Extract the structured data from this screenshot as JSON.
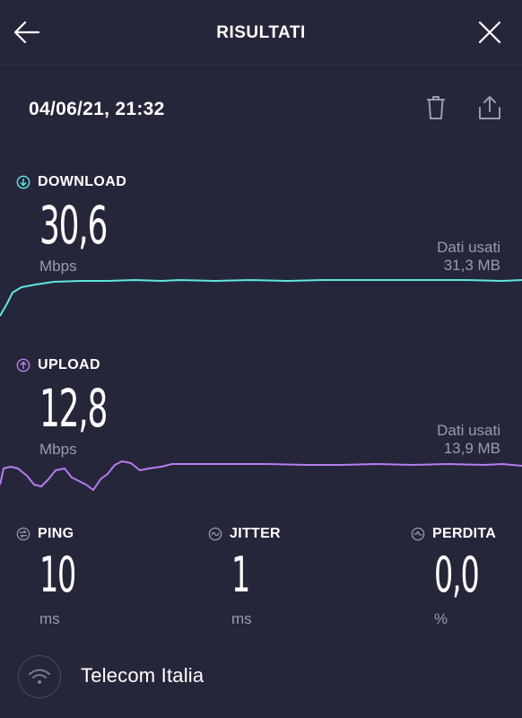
{
  "header": {
    "title": "RISULTATI"
  },
  "result": {
    "datetime": "04/06/21, 21:32"
  },
  "download": {
    "label": "DOWNLOAD",
    "value": "30,6",
    "unit": "Mbps",
    "data_used_label": "Dati usati",
    "data_used_value": "31,3 MB",
    "color": "#5ee8e0"
  },
  "upload": {
    "label": "UPLOAD",
    "value": "12,8",
    "unit": "Mbps",
    "data_used_label": "Dati usati",
    "data_used_value": "13,9 MB",
    "color": "#b77cf0"
  },
  "ping": {
    "label": "PING",
    "value": "10",
    "unit": "ms"
  },
  "jitter": {
    "label": "JITTER",
    "value": "1",
    "unit": "ms"
  },
  "loss": {
    "label": "PERDITA",
    "value": "0,0",
    "unit": "%"
  },
  "isp": {
    "name": "Telecom Italia"
  },
  "icons": {
    "back": "arrow-left-icon",
    "close": "close-icon",
    "delete": "trash-icon",
    "share": "share-icon",
    "download": "arrow-down-circle-icon",
    "upload": "arrow-up-circle-icon",
    "ping": "ping-icon",
    "jitter": "jitter-icon",
    "loss": "loss-icon",
    "wifi": "wifi-icon"
  }
}
